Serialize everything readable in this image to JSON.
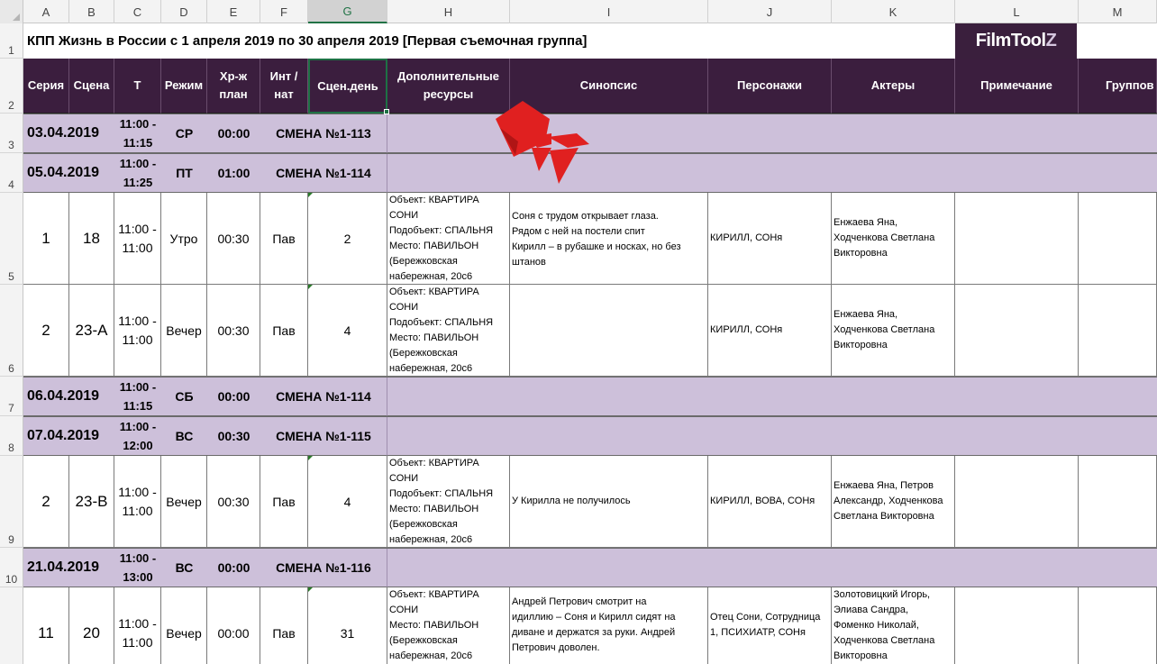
{
  "columns": [
    "A",
    "B",
    "C",
    "D",
    "E",
    "F",
    "G",
    "H",
    "I",
    "J",
    "K",
    "L",
    "M"
  ],
  "selected_column": "G",
  "title": "КПП Жизнь в России с 1 апреля 2019 по 30 апреля 2019 [Первая съемочная группа]",
  "logo": {
    "text_main": "FilmTool",
    "text_z": "Z"
  },
  "headers": {
    "A": "Серия",
    "B": "Сцена",
    "C": "Т",
    "D": "Режим",
    "E": "Хр-ж план",
    "F": "Инт / нат",
    "G": "Сцен.день",
    "H": "Дополнительные ресурсы",
    "I": "Синопсис",
    "J": "Персонажи",
    "K": "Актеры",
    "L": "Примечание",
    "M": "Группов"
  },
  "rows": [
    {
      "num": "1"
    },
    {
      "num": "2"
    },
    {
      "num": "3",
      "type": "shift",
      "date": "03.04.2019",
      "time_a": "11:00 -",
      "time_b": "11:15",
      "day": "СР",
      "dur": "00:00",
      "shift": "СМЕНА №1-113"
    },
    {
      "num": "4",
      "type": "shift",
      "date": "05.04.2019",
      "time_a": "11:00 -",
      "time_b": "11:25",
      "day": "ПТ",
      "dur": "01:00",
      "shift": "СМЕНА №1-114"
    },
    {
      "num": "5",
      "type": "scene",
      "series": "1",
      "scene": "18",
      "time_a": "11:00 -",
      "time_b": "11:00",
      "mode": "Утро",
      "dur": "00:30",
      "intnat": "Пав",
      "day": "2",
      "resources": [
        "Объект: КВАРТИРА",
        "СОНИ",
        "Подобъект: СПАЛЬНЯ",
        "Место: ПАВИЛЬОН",
        "(Бережковская",
        "набережная, 20с6"
      ],
      "synopsis": [
        "Соня с трудом открывает глаза.",
        "Рядом с ней на постели спит",
        "Кирилл – в рубашке и носках, но без",
        "штанов"
      ],
      "characters": [
        "КИРИЛЛ, СОНя"
      ],
      "actors": [
        "Енжаева Яна,",
        "Ходченкова  Светлана",
        "Викторовна"
      ]
    },
    {
      "num": "6",
      "type": "scene",
      "series": "2",
      "scene": "23-А",
      "time_a": "11:00 -",
      "time_b": "11:00",
      "mode": "Вечер",
      "dur": "00:30",
      "intnat": "Пав",
      "day": "4",
      "resources": [
        "Объект: КВАРТИРА",
        "СОНИ",
        "Подобъект: СПАЛЬНЯ",
        "Место: ПАВИЛЬОН",
        "(Бережковская",
        "набережная, 20с6"
      ],
      "synopsis": [],
      "characters": [
        "КИРИЛЛ, СОНя"
      ],
      "actors": [
        "Енжаева Яна,",
        "Ходченкова  Светлана",
        "Викторовна"
      ]
    },
    {
      "num": "7",
      "type": "shift",
      "date": "06.04.2019",
      "time_a": "11:00 -",
      "time_b": "11:15",
      "day": "СБ",
      "dur": "00:00",
      "shift": "СМЕНА №1-114"
    },
    {
      "num": "8",
      "type": "shift",
      "date": "07.04.2019",
      "time_a": "11:00 -",
      "time_b": "12:00",
      "day": "ВС",
      "dur": "00:30",
      "shift": "СМЕНА №1-115"
    },
    {
      "num": "9",
      "type": "scene",
      "series": "2",
      "scene": "23-В",
      "time_a": "11:00 -",
      "time_b": "11:00",
      "mode": "Вечер",
      "dur": "00:30",
      "intnat": "Пав",
      "day": "4",
      "resources": [
        "Объект: КВАРТИРА",
        "СОНИ",
        "Подобъект: СПАЛЬНЯ",
        "Место: ПАВИЛЬОН",
        "(Бережковская",
        "набережная, 20с6"
      ],
      "synopsis": [
        "У Кирилла не получилось"
      ],
      "characters": [
        "КИРИЛЛ, ВОВА, СОНя"
      ],
      "actors": [
        "Енжаева Яна, Петров",
        "Александр, Ходченкова",
        "Светлана Викторовна"
      ]
    },
    {
      "num": "10",
      "type": "shift",
      "date": "21.04.2019",
      "time_a": "11:00 -",
      "time_b": "13:00",
      "day": "ВС",
      "dur": "00:00",
      "shift": "СМЕНА №1-116"
    },
    {
      "num": "11",
      "type": "scene",
      "series": "11",
      "scene": "20",
      "time_a": "11:00 -",
      "time_b": "11:00",
      "mode": "Вечер",
      "dur": "00:00",
      "intnat": "Пав",
      "day": "31",
      "resources": [
        "Объект: КВАРТИРА",
        "СОНИ",
        "Место: ПАВИЛЬОН",
        "(Бережковская",
        "набережная, 20с6"
      ],
      "synopsis": [
        "Андрей Петрович смотрит на",
        "идиллию – Соня и Кирилл сидят на",
        "диване и держатся за руки. Андрей",
        "Петрович доволен."
      ],
      "characters": [
        "Отец Сони, Сотрудница",
        "1, ПСИХИАТР, СОНя"
      ],
      "actors": [
        "Золотовицкий Игорь,",
        "Элиава Сандра,",
        "Фоменко Николай,",
        "Ходченкова  Светлана",
        "Викторовна"
      ]
    }
  ],
  "colors": {
    "header_bg": "#3b1e3e",
    "shift_bg": "#cdc0da",
    "selection": "#1e7145",
    "watermark": "#e02020"
  }
}
